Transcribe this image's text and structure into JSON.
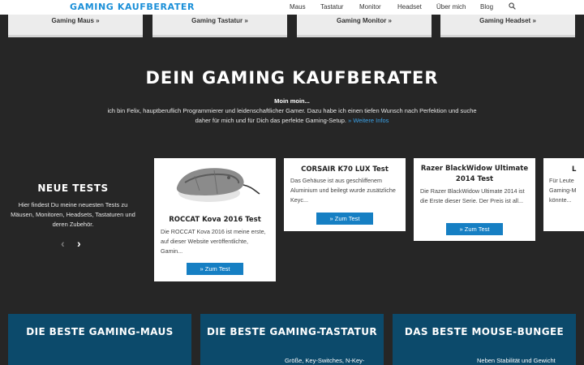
{
  "header": {
    "logo": "GAMING KAUFBERATER",
    "nav": [
      "Maus",
      "Tastatur",
      "Monitor",
      "Headset",
      "Über mich",
      "Blog"
    ]
  },
  "categories": [
    "Gaming Maus »",
    "Gaming Tastatur »",
    "Gaming Monitor »",
    "Gaming Headset »"
  ],
  "hero": {
    "title": "DEIN GAMING KAUFBERATER",
    "greeting": "Moin moin...",
    "text": "ich bin Felix, hauptberuflich Programmierer und leidenschaftlicher Gamer. Dazu habe ich einen tiefen Wunsch nach Perfektion und suche daher für mich und für Dich das perfekte Gaming-Setup.",
    "link": "» Weitere Infos"
  },
  "neue_tests": {
    "title": "NEUE TESTS",
    "text": "Hier findest Du meine neuesten Tests zu Mäusen, Monitoren, Headsets, Tastaturen und deren Zubehör.",
    "prev": "‹",
    "next": "›"
  },
  "reviews": [
    {
      "title": "ROCCAT Kova 2016 Test",
      "excerpt": "Die ROCCAT Kova 2016 ist meine erste, auf dieser Website veröffentlichte, Gamin...",
      "button": "» Zum Test"
    },
    {
      "title": "CORSAIR K70 LUX Test",
      "excerpt": "Das Gehäuse ist aus geschliffenem Aluminium und beilegt wurde zusätzliche Keyc...",
      "button": "» Zum Test"
    },
    {
      "title": "Razer BlackWidow Ultimate 2014 Test",
      "excerpt": "Die Razer BlackWidow Ultimate 2014 ist die Erste dieser Serie. Der Preis ist all...",
      "button": "» Zum Test"
    },
    {
      "title": "L",
      "excerpt": "Für Leute Gaming-M könnte...",
      "button": ""
    }
  ],
  "bottom": [
    {
      "title": "DIE BESTE GAMING-MAUS",
      "sub": ""
    },
    {
      "title": "DIE BESTE GAMING-TASTATUR",
      "sub": "Größe, Key-Switches, N-Key-"
    },
    {
      "title": "DAS BESTE MOUSE-BUNGEE",
      "sub": "Neben Stabilität und Gewicht"
    }
  ],
  "colors": {
    "accent": "#1a8fd8",
    "button": "#167fc3",
    "bottom_box": "#0c4a6b",
    "background": "#262626"
  }
}
